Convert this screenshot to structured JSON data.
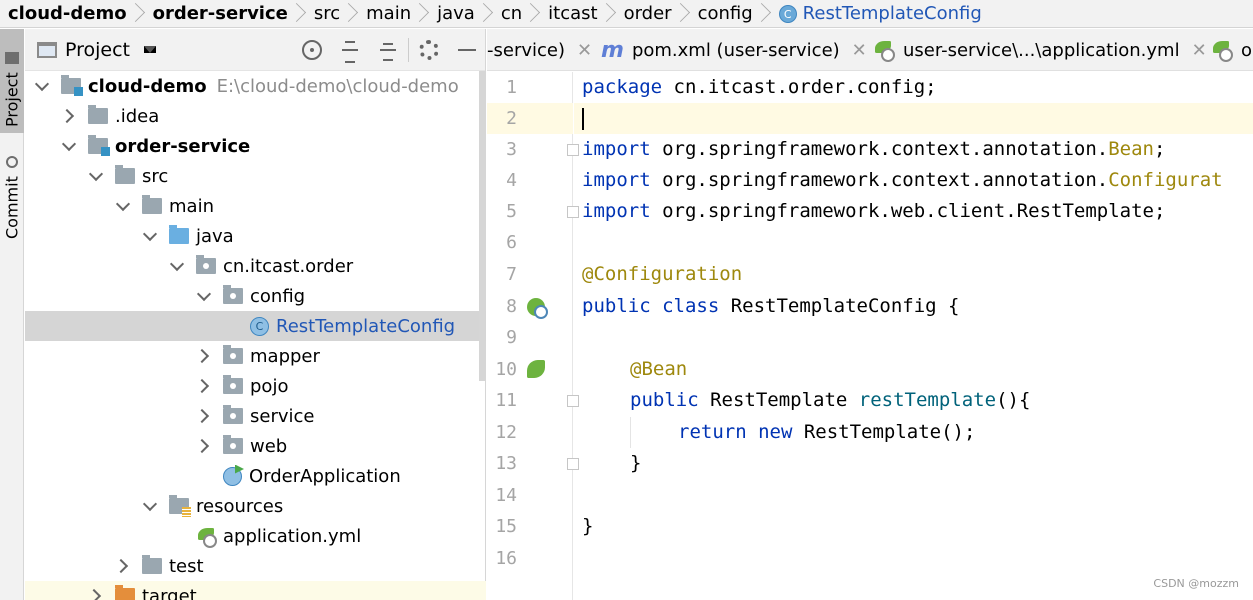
{
  "breadcrumb": {
    "items": [
      "cloud-demo",
      "order-service",
      "src",
      "main",
      "java",
      "cn",
      "itcast",
      "order",
      "config",
      "RestTemplateConfig"
    ],
    "current_icon_letter": "C"
  },
  "stripe": {
    "project_label": "Project",
    "commit_label": "Commit"
  },
  "project_panel": {
    "title": "Project",
    "tree": [
      {
        "label": "cloud-demo",
        "path": "E:\\cloud-demo\\cloud-demo"
      },
      {
        "label": ".idea"
      },
      {
        "label": "order-service"
      },
      {
        "label": "src"
      },
      {
        "label": "main"
      },
      {
        "label": "java"
      },
      {
        "label": "cn.itcast.order"
      },
      {
        "label": "config"
      },
      {
        "label": "RestTemplateConfig",
        "icon_letter": "C"
      },
      {
        "label": "mapper"
      },
      {
        "label": "pojo"
      },
      {
        "label": "service"
      },
      {
        "label": "web"
      },
      {
        "label": "OrderApplication"
      },
      {
        "label": "resources"
      },
      {
        "label": "application.yml"
      },
      {
        "label": "test"
      },
      {
        "label": "target"
      }
    ]
  },
  "editor": {
    "tabs": [
      {
        "label": "-service)"
      },
      {
        "label": "pom.xml (user-service)",
        "icon": "m"
      },
      {
        "label": "user-service\\...\\application.yml"
      },
      {
        "label": "o"
      }
    ],
    "line_numbers": [
      "1",
      "2",
      "3",
      "4",
      "5",
      "6",
      "7",
      "8",
      "9",
      "10",
      "11",
      "12",
      "13",
      "14",
      "15",
      "16"
    ],
    "code": {
      "l1_kw": "package",
      "l1_rest": " cn.itcast.order.config;",
      "l3_kw": "import",
      "l3_rest": " org.springframework.context.annotation.",
      "l3_ann": "Bean",
      "l3_end": ";",
      "l4_kw": "import",
      "l4_rest": " org.springframework.context.annotation.",
      "l4_ann": "Configurat",
      "l5_kw": "import",
      "l5_rest": " org.springframework.web.client.RestTemplate;",
      "l7_ann": "@Configuration",
      "l8_kw": "public class",
      "l8_rest": " RestTemplateConfig {",
      "l10_ann": "@Bean",
      "l11_kw": "public",
      "l11_type": " RestTemplate ",
      "l11_fn": "restTemplate",
      "l11_end": "(){",
      "l12_kw": "return new",
      "l12_rest": " RestTemplate();",
      "l13": "}",
      "l15": "}"
    }
  },
  "watermark": "CSDN @mozzm"
}
